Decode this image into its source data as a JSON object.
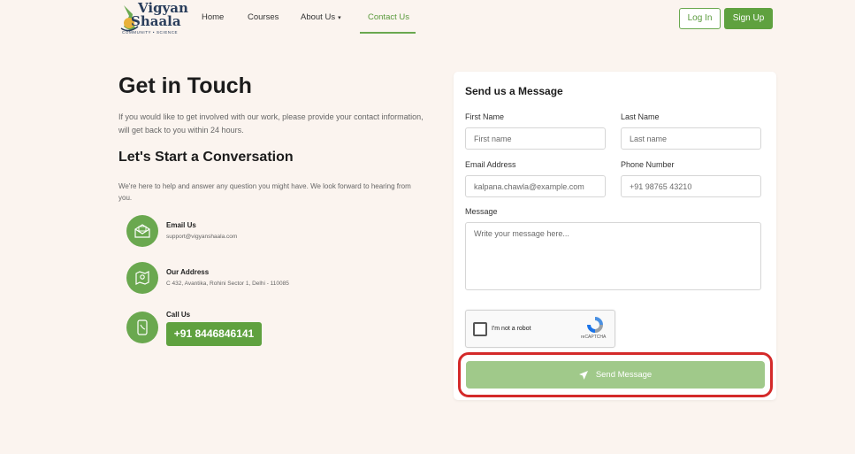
{
  "nav": {
    "logo": {
      "line1": "Vigyan",
      "line2": "Shaala",
      "tagline": "COMMUNITY • SCIENCE"
    },
    "links": [
      "Home",
      "Courses",
      "About Us",
      "Contact Us"
    ],
    "active_link": "Contact Us",
    "login_label": "Log In",
    "signup_label": "Sign Up"
  },
  "intro": {
    "title": "Get in Touch",
    "text": "If you would like to get involved with our work, please provide your contact information, will get back to you within 24 hours.",
    "subtitle": "Let's Start a Conversation",
    "subtext": "We're here to help and answer any question you might have. We look forward to hearing from you."
  },
  "contacts": [
    {
      "title": "Email Us",
      "text": "support@vigyanshaala.com",
      "icon": "envelope-icon"
    },
    {
      "title": "Our Address",
      "text": "C 432, Avantika, Rohini Sector 1, Delhi - 110085",
      "icon": "map-icon"
    },
    {
      "title": "Call Us",
      "text": "+91 8446846141",
      "icon": "phone-icon"
    }
  ],
  "form": {
    "title": "Send us a Message",
    "first_name_label": "First Name",
    "first_name_placeholder": "First name",
    "last_name_label": "Last Name",
    "last_name_placeholder": "Last name",
    "email_label": "Email Address",
    "email_placeholder": "kalpana.chawla@example.com",
    "phone_label": "Phone Number",
    "phone_placeholder": "+91 98765 43210",
    "message_label": "Message",
    "message_placeholder": "Write your message here...",
    "captcha_label": "I'm not a robot",
    "captcha_brand": "reCAPTCHA",
    "send_label": "Send Message"
  },
  "colors": {
    "brand_green": "#5fa13f",
    "send_disabled": "#a0c98a",
    "highlight": "#d42a2a",
    "background": "#fbf4ef"
  }
}
